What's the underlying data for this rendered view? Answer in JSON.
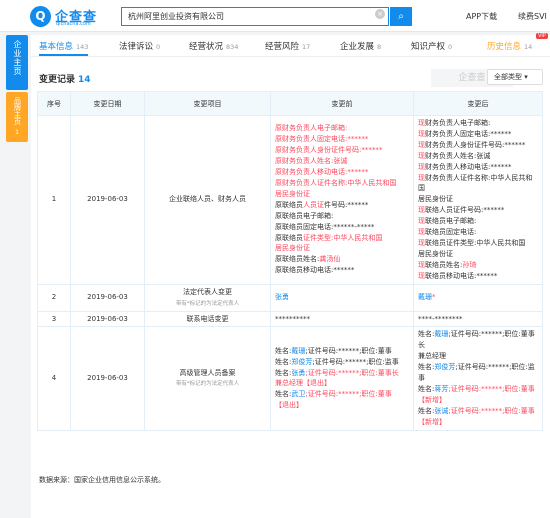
{
  "header": {
    "logo_glyph": "Q",
    "logo_text": "企查查",
    "logo_domain": "qichacha.com",
    "search_value": "杭州阿里创业投资有限公司",
    "search_icon": "search-icon",
    "clear_icon": "clear-icon",
    "app_download": "APP下载",
    "renew_vip": "续费SVI"
  },
  "side_tabs": {
    "enterprise": "企业主页",
    "brand": "品牌主页",
    "brand_badge": "1"
  },
  "tabs": [
    {
      "label": "基本信息",
      "count": "143"
    },
    {
      "label": "法律诉讼",
      "count": "0"
    },
    {
      "label": "经营状况",
      "count": "834"
    },
    {
      "label": "经营风险",
      "count": "17"
    },
    {
      "label": "企业发展",
      "count": "8"
    },
    {
      "label": "知识产权",
      "count": "0"
    },
    {
      "label": "历史信息",
      "count": "14"
    }
  ],
  "vip_badge": "VIP",
  "section": {
    "title": "变更记录",
    "count": "14",
    "watermark": "企查查",
    "type_filter": "全部类型"
  },
  "table": {
    "headers": [
      "序号",
      "变更日期",
      "变更项目",
      "变更前",
      "变更后"
    ],
    "rows": [
      {
        "no": "1",
        "date": "2019-06-03",
        "item": "企业联络人员、财务人员",
        "tip": "",
        "before": [
          {
            "parts": [
              {
                "t": "原财务负责人电子邮箱:",
                "c": "red"
              }
            ]
          },
          {
            "parts": [
              {
                "t": "原财务负责人固定电话:******",
                "c": "red"
              }
            ]
          },
          {
            "parts": [
              {
                "t": "原财务负责人身份证件号码:******",
                "c": "red"
              }
            ]
          },
          {
            "parts": [
              {
                "t": "原财务负责人姓名:张诚",
                "c": "red"
              }
            ]
          },
          {
            "parts": [
              {
                "t": "原财务负责人移动电话:******",
                "c": "red"
              }
            ]
          },
          {
            "parts": [
              {
                "t": "原财务负责人证件名称:中华人民共和国",
                "c": "red"
              }
            ]
          },
          {
            "parts": [
              {
                "t": "居民身份证",
                "c": "red"
              }
            ]
          },
          {
            "parts": [
              {
                "t": "原联络员",
                "c": ""
              },
              {
                "t": "人员证",
                "c": "red"
              },
              {
                "t": "件号码:******",
                "c": ""
              }
            ]
          },
          {
            "parts": [
              {
                "t": "原联络员电子邮箱:",
                "c": ""
              }
            ]
          },
          {
            "parts": [
              {
                "t": "原联络员固定电话:******-*****",
                "c": ""
              }
            ]
          },
          {
            "parts": [
              {
                "t": "原联络员",
                "c": ""
              },
              {
                "t": "证件类型:中华人民共和国",
                "c": "red"
              }
            ]
          },
          {
            "parts": [
              {
                "t": "居民身份证",
                "c": "red"
              }
            ]
          },
          {
            "parts": [
              {
                "t": "原联络员姓名:",
                "c": ""
              },
              {
                "t": "龚汤仙",
                "c": "red"
              }
            ]
          },
          {
            "parts": [
              {
                "t": "原联络员移动电话:******",
                "c": ""
              }
            ]
          }
        ],
        "after": [
          {
            "parts": [
              {
                "t": "现",
                "c": "red"
              },
              {
                "t": "财务负责人电子邮箱:",
                "c": ""
              }
            ]
          },
          {
            "parts": [
              {
                "t": "现",
                "c": "red"
              },
              {
                "t": "财务负责人固定电话:******",
                "c": ""
              }
            ]
          },
          {
            "parts": [
              {
                "t": "现",
                "c": "red"
              },
              {
                "t": "财务负责人身份证件号码:******",
                "c": ""
              }
            ]
          },
          {
            "parts": [
              {
                "t": "现",
                "c": "red"
              },
              {
                "t": "财务负责人姓名:张诚",
                "c": ""
              }
            ]
          },
          {
            "parts": [
              {
                "t": "现",
                "c": "red"
              },
              {
                "t": "财务负责人移动电话:******",
                "c": ""
              }
            ]
          },
          {
            "parts": [
              {
                "t": "现",
                "c": "red"
              },
              {
                "t": "财务负责人证件名称:中华人民共和国",
                "c": ""
              }
            ]
          },
          {
            "parts": [
              {
                "t": "居民身份证",
                "c": ""
              }
            ]
          },
          {
            "parts": [
              {
                "t": "现",
                "c": "red"
              },
              {
                "t": "联络人员证件号码:******",
                "c": ""
              }
            ]
          },
          {
            "parts": [
              {
                "t": "现",
                "c": "red"
              },
              {
                "t": "联络员电子邮箱:",
                "c": ""
              }
            ]
          },
          {
            "parts": [
              {
                "t": "现",
                "c": "red"
              },
              {
                "t": "联络员固定电话:",
                "c": ""
              }
            ]
          },
          {
            "parts": [
              {
                "t": "现",
                "c": "red"
              },
              {
                "t": "联络员证件类型:中华人民共和国",
                "c": ""
              }
            ]
          },
          {
            "parts": [
              {
                "t": "居民身份证",
                "c": ""
              }
            ]
          },
          {
            "parts": [
              {
                "t": "现",
                "c": "red"
              },
              {
                "t": "联络员姓名:",
                "c": ""
              },
              {
                "t": "孙琦",
                "c": "red"
              }
            ]
          },
          {
            "parts": [
              {
                "t": "现",
                "c": "red"
              },
              {
                "t": "联络员移动电话:******",
                "c": ""
              }
            ]
          }
        ]
      },
      {
        "no": "2",
        "date": "2019-06-03",
        "item": "法定代表人变更",
        "tip": "带有*标记的为法定代表人",
        "before": [
          {
            "parts": [
              {
                "t": "张勇",
                "c": "blue"
              }
            ]
          }
        ],
        "after": [
          {
            "parts": [
              {
                "t": "戴珊",
                "c": "blue"
              },
              {
                "t": "*",
                "c": "red"
              }
            ]
          }
        ]
      },
      {
        "no": "3",
        "date": "2019-06-03",
        "item": "联系电话变更",
        "tip": "",
        "before": [
          {
            "parts": [
              {
                "t": "**********",
                "c": ""
              }
            ]
          }
        ],
        "after": [
          {
            "parts": [
              {
                "t": "****-********",
                "c": ""
              }
            ]
          }
        ]
      },
      {
        "no": "4",
        "date": "2019-06-03",
        "item": "高级管理人员备案",
        "tip": "带有*标记的为法定代表人",
        "before": [
          {
            "parts": [
              {
                "t": "姓名:",
                "c": ""
              },
              {
                "t": "戴珊",
                "c": "blue"
              },
              {
                "t": ";证件号码:******;职位:董事",
                "c": ""
              }
            ]
          },
          {
            "parts": [
              {
                "t": "姓名:",
                "c": ""
              },
              {
                "t": "郑俊芳",
                "c": "blue"
              },
              {
                "t": ";证件号码:******;职位:监事",
                "c": ""
              }
            ]
          },
          {
            "parts": [
              {
                "t": "姓名:",
                "c": ""
              },
              {
                "t": "张勇",
                "c": "blue"
              },
              {
                "t": ";证件号码:******;职位:董事长",
                "c": "red"
              }
            ]
          },
          {
            "parts": [
              {
                "t": "兼总经理【退出】",
                "c": "red"
              }
            ]
          },
          {
            "parts": [
              {
                "t": "姓名:",
                "c": ""
              },
              {
                "t": "武卫",
                "c": "blue"
              },
              {
                "t": ";证件号码:******;职位:董事",
                "c": "red"
              }
            ]
          },
          {
            "parts": [
              {
                "t": "【退出】",
                "c": "red"
              }
            ]
          }
        ],
        "after": [
          {
            "parts": [
              {
                "t": "姓名:",
                "c": ""
              },
              {
                "t": "戴珊",
                "c": "blue"
              },
              {
                "t": ";证件号码:******;职位:董事长",
                "c": ""
              }
            ]
          },
          {
            "parts": [
              {
                "t": "兼总经理",
                "c": ""
              }
            ]
          },
          {
            "parts": [
              {
                "t": "姓名:",
                "c": ""
              },
              {
                "t": "郑俊芳",
                "c": "blue"
              },
              {
                "t": ";证件号码:******;职位:监事",
                "c": ""
              }
            ]
          },
          {
            "parts": [
              {
                "t": "姓名:",
                "c": ""
              },
              {
                "t": "蒋芳",
                "c": "blue"
              },
              {
                "t": ";证件号码:******;职位:董事",
                "c": "red"
              }
            ]
          },
          {
            "parts": [
              {
                "t": "【新增】",
                "c": "red"
              }
            ]
          },
          {
            "parts": [
              {
                "t": "姓名:",
                "c": ""
              },
              {
                "t": "张诚",
                "c": "blue"
              },
              {
                "t": ";证件号码:******;职位:董事",
                "c": "red"
              }
            ]
          },
          {
            "parts": [
              {
                "t": "【新增】",
                "c": "red"
              }
            ]
          }
        ]
      }
    ]
  },
  "source_note": "数据来源：国家企业信用信息公示系统。",
  "colors": {
    "accent": "#128bed",
    "red": "#fd485e",
    "orange": "#ffa725"
  }
}
